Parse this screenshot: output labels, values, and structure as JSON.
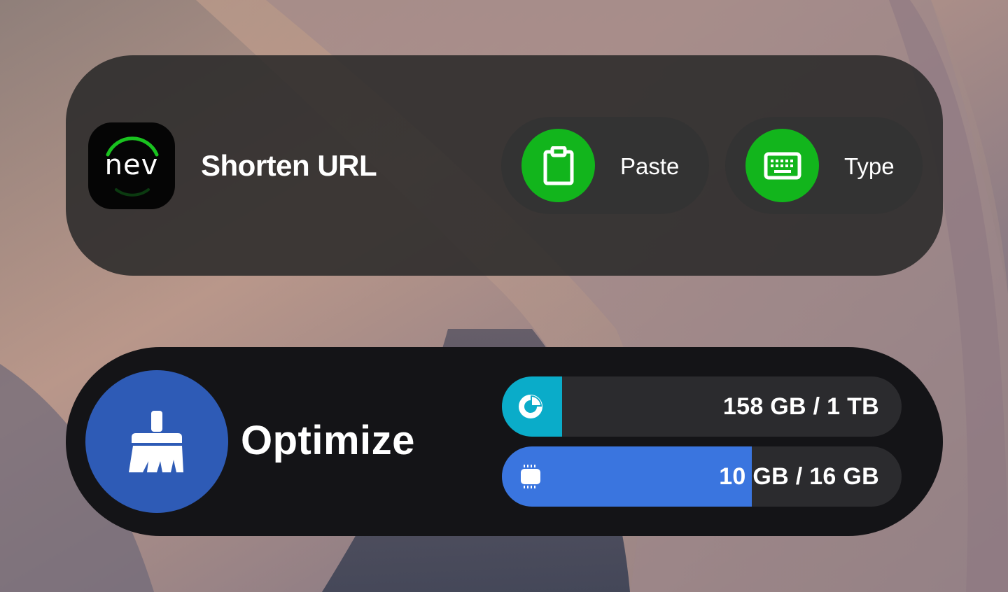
{
  "shorten_widget": {
    "app_icon_text": "nev",
    "title": "Shorten URL",
    "actions": [
      {
        "label": "Paste",
        "icon": "clipboard-icon"
      },
      {
        "label": "Type",
        "icon": "keyboard-icon"
      }
    ],
    "accent_color": "#12b51c"
  },
  "optimize_widget": {
    "title": "Optimize",
    "icon": "broom-icon",
    "icon_bg_color": "#2e5bb6",
    "storage": {
      "text": "158 GB / 1 TB",
      "used_fraction": 0.15,
      "icon": "pie-chart-icon",
      "color": "#0aacc9"
    },
    "memory": {
      "text": "10 GB / 16 GB",
      "used_fraction": 0.625,
      "icon": "memory-chip-icon",
      "color": "#3a75df"
    }
  }
}
